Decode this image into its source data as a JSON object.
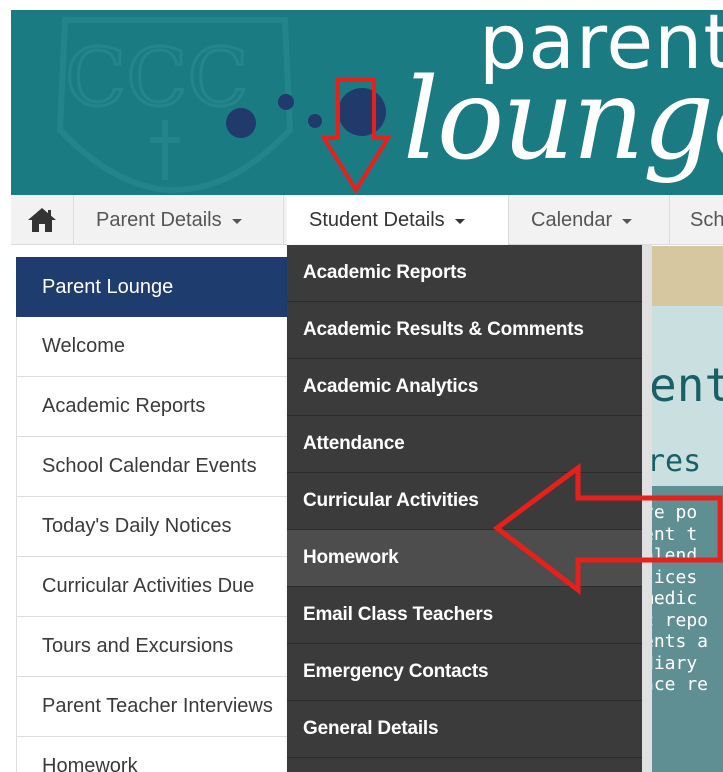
{
  "brand": {
    "word_top": "parent",
    "word_script": "lounge",
    "crest_letters": "CCC"
  },
  "navbar": {
    "home_icon": "home-icon",
    "items": [
      {
        "label": "Parent Details"
      },
      {
        "label": "Student Details"
      },
      {
        "label": "Calendar"
      },
      {
        "label": "Sch"
      }
    ]
  },
  "sidebar": {
    "items": [
      {
        "label": "Parent Lounge"
      },
      {
        "label": "Welcome"
      },
      {
        "label": "Academic Reports"
      },
      {
        "label": "School Calendar Events"
      },
      {
        "label": "Today's Daily Notices"
      },
      {
        "label": "Curricular Activities Due"
      },
      {
        "label": "Tours and Excursions"
      },
      {
        "label": "Parent Teacher Interviews"
      },
      {
        "label": "Homework"
      }
    ]
  },
  "dropdown": {
    "items": [
      {
        "label": "Academic Reports"
      },
      {
        "label": "Academic Results & Comments"
      },
      {
        "label": "Academic Analytics"
      },
      {
        "label": "Attendance"
      },
      {
        "label": "Curricular Activities"
      },
      {
        "label": "Homework"
      },
      {
        "label": "Email Class Teachers"
      },
      {
        "label": "Emergency Contacts"
      },
      {
        "label": "General Details"
      }
    ]
  },
  "content": {
    "big_text": "ent",
    "sub_text": "res",
    "lines": [
      "ve po",
      "ent t",
      "alend",
      "tices",
      "medic",
      "c repo",
      "ents a",
      "diary",
      "nce re"
    ]
  },
  "colors": {
    "banner": "#1b7b82",
    "sidebar_header": "#1f3c6e",
    "dropdown": "#3b3b3b",
    "annotation": "#e8201c"
  }
}
